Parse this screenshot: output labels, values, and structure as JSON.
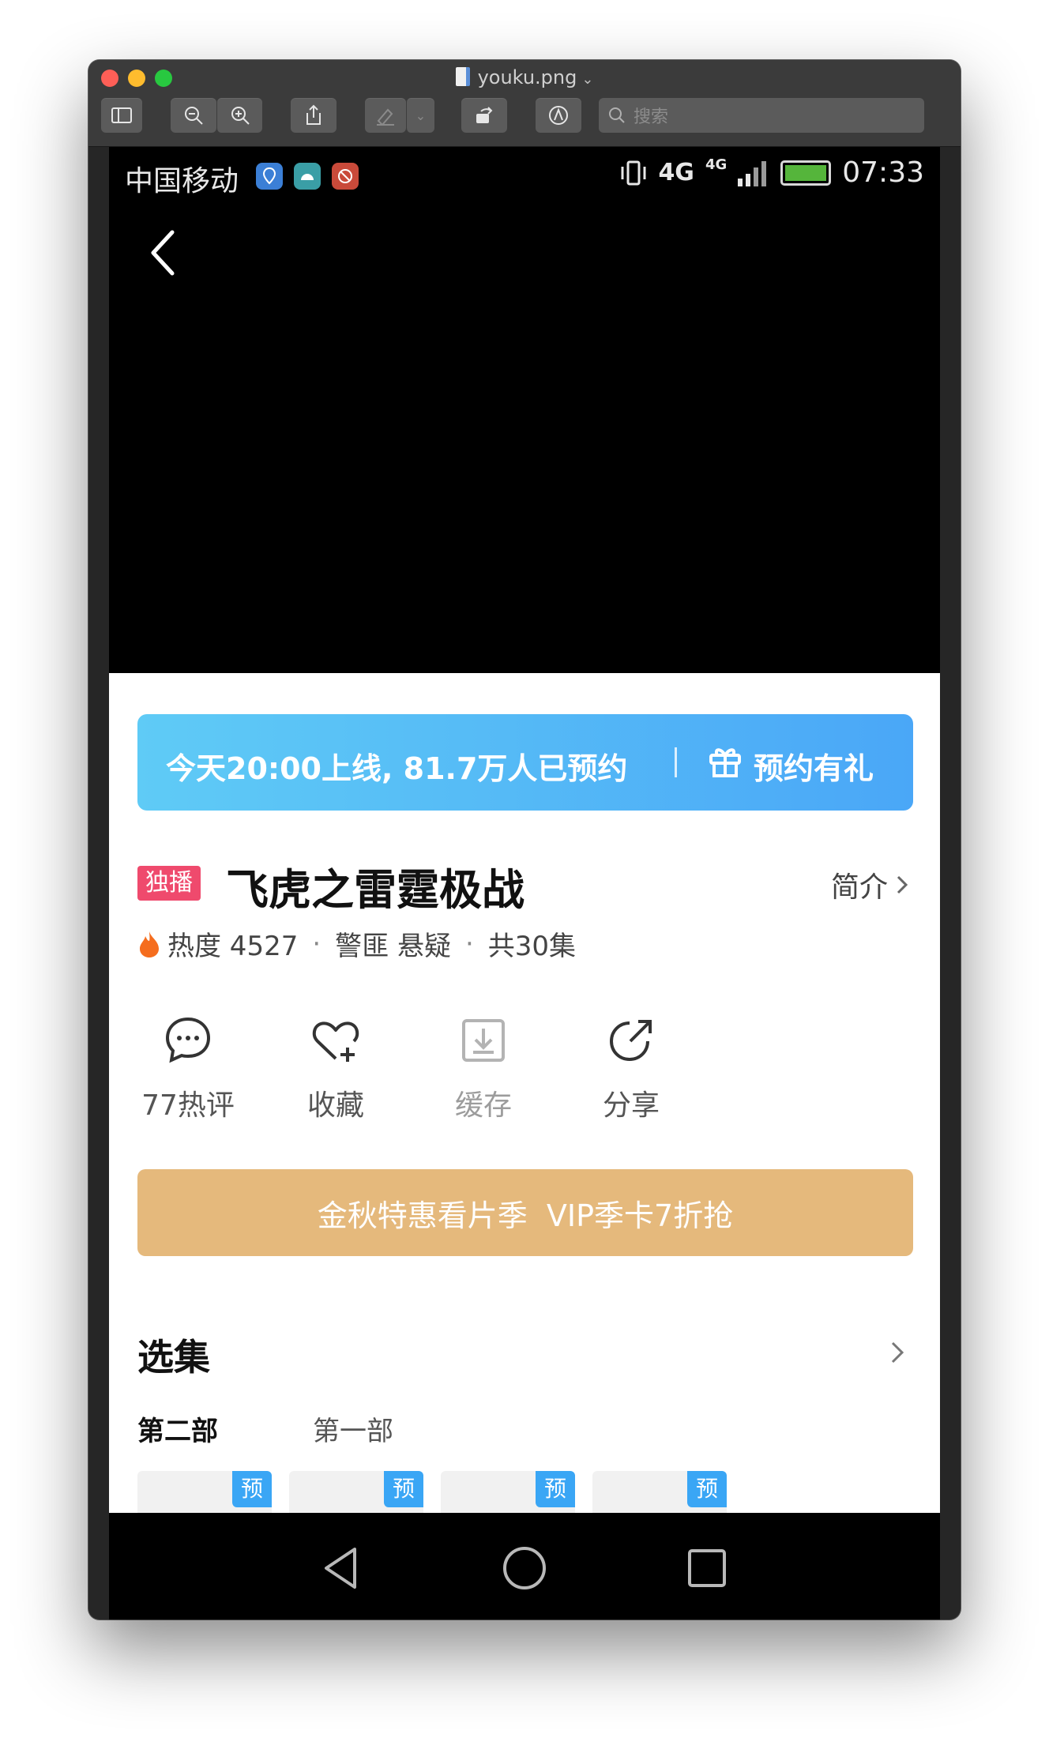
{
  "window": {
    "file_name": "youku.png",
    "search_placeholder": "搜索"
  },
  "statusbar": {
    "carrier": "中国移动",
    "network_1": "4G",
    "network_2": "4G",
    "time": "07:33"
  },
  "reserve_banner": {
    "text": "今天20:00上线, 81.7万人已预约",
    "gift_label": "预约有礼"
  },
  "show": {
    "tag": "独播",
    "title": "飞虎之雷霆极战",
    "intro_label": "简介",
    "heat_label": "热度 4527",
    "genres": "警匪 悬疑",
    "episodes_total": "共30集"
  },
  "actions": [
    {
      "label": "77热评",
      "icon": "comment-icon"
    },
    {
      "label": "收藏",
      "icon": "favorite-add-icon"
    },
    {
      "label": "缓存",
      "icon": "download-icon"
    },
    {
      "label": "分享",
      "icon": "share-icon"
    }
  ],
  "vip_banner": {
    "text": "金秋特惠看片季  VIP季卡7折抢"
  },
  "episodes": {
    "title": "选集",
    "tabs": [
      {
        "label": "第二部",
        "active": true
      },
      {
        "label": "第一部",
        "active": false
      }
    ],
    "badge": "预"
  },
  "colors": {
    "banner_start": "#5fcbf6",
    "banner_end": "#4aa7f7",
    "tag": "#ef4a6d",
    "vip": "#e5b97c",
    "badge": "#3aa6f5"
  }
}
